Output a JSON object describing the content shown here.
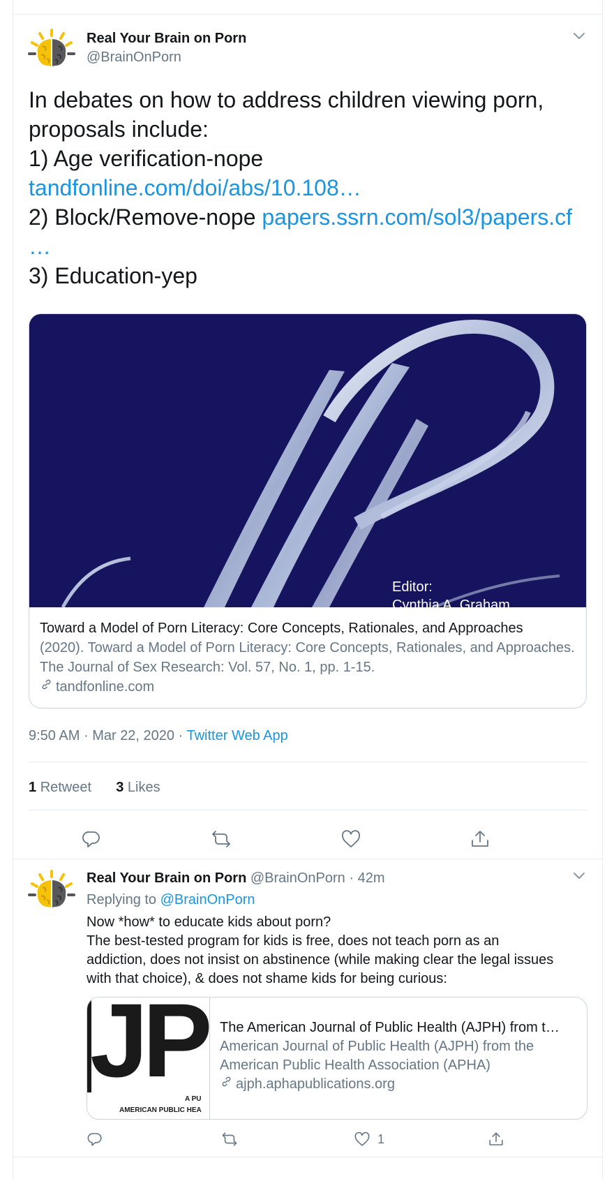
{
  "main_tweet": {
    "author_name": "Real Your Brain on Porn",
    "author_handle": "@BrainOnPorn",
    "body": {
      "line1": "In debates on how to address children viewing porn,",
      "line2": "proposals include:",
      "line3": "1) Age verification-nope",
      "link1": "tandfonline.com/doi/abs/10.108…",
      "line5_text": "2) Block/Remove-nope ",
      "link2": "papers.ssrn.com/sol3/papers.cf",
      "link2_cont": "…",
      "line7": "3) Education-yep"
    },
    "card": {
      "image_editor_label": "Editor:",
      "image_editor_name": "Cynthia A. Graham",
      "title": "Toward a Model of Porn Literacy: Core Concepts, Rationales, and Approaches",
      "description": "(2020). Toward a Model of Porn Literacy: Core Concepts, Rationales, and Approaches. The Journal of Sex Research: Vol. 57, No. 1, pp. 1-15.",
      "domain": "tandfonline.com"
    },
    "time": "9:50 AM",
    "date": "Mar 22, 2020",
    "separator": "·",
    "source": "Twitter Web App",
    "retweet_count": "1",
    "retweet_label": "Retweet",
    "like_count": "3",
    "like_label": "Likes"
  },
  "reply_tweet": {
    "author_name": "Real Your Brain on Porn",
    "author_handle": "@BrainOnPorn",
    "separator": "·",
    "relative_time": "42m",
    "replying_to_label": "Replying to",
    "replying_to_handle": "@BrainOnPorn",
    "body": {
      "line1": "Now *how* to educate kids about porn?",
      "line2": "The best-tested program for kids is free, does not teach porn as an",
      "line3": "addiction, does not insist on abstinence (while making clear the legal issues",
      "line4": "with that choice), & does not shame kids for being curious:"
    },
    "card": {
      "thumb_logo": "JP",
      "thumb_small_text": "A PU",
      "thumb_caption": "AMERICAN PUBLIC HEA",
      "title": "The American Journal of Public Health (AJPH) from t…",
      "description": "American Journal of Public Health (AJPH) from the American Public Health Association (APHA)",
      "domain": "ajph.aphapublications.org"
    },
    "like_count": "1"
  },
  "icons": {
    "caret": "chevron-down-icon",
    "reply": "reply-icon",
    "retweet": "retweet-icon",
    "like": "heart-icon",
    "share": "share-icon",
    "link": "link-icon"
  },
  "colors": {
    "link": "#1b95e0",
    "muted": "#657786",
    "text": "#14171a",
    "border": "#e6ecf0",
    "card_image_bg": "#16145e"
  }
}
